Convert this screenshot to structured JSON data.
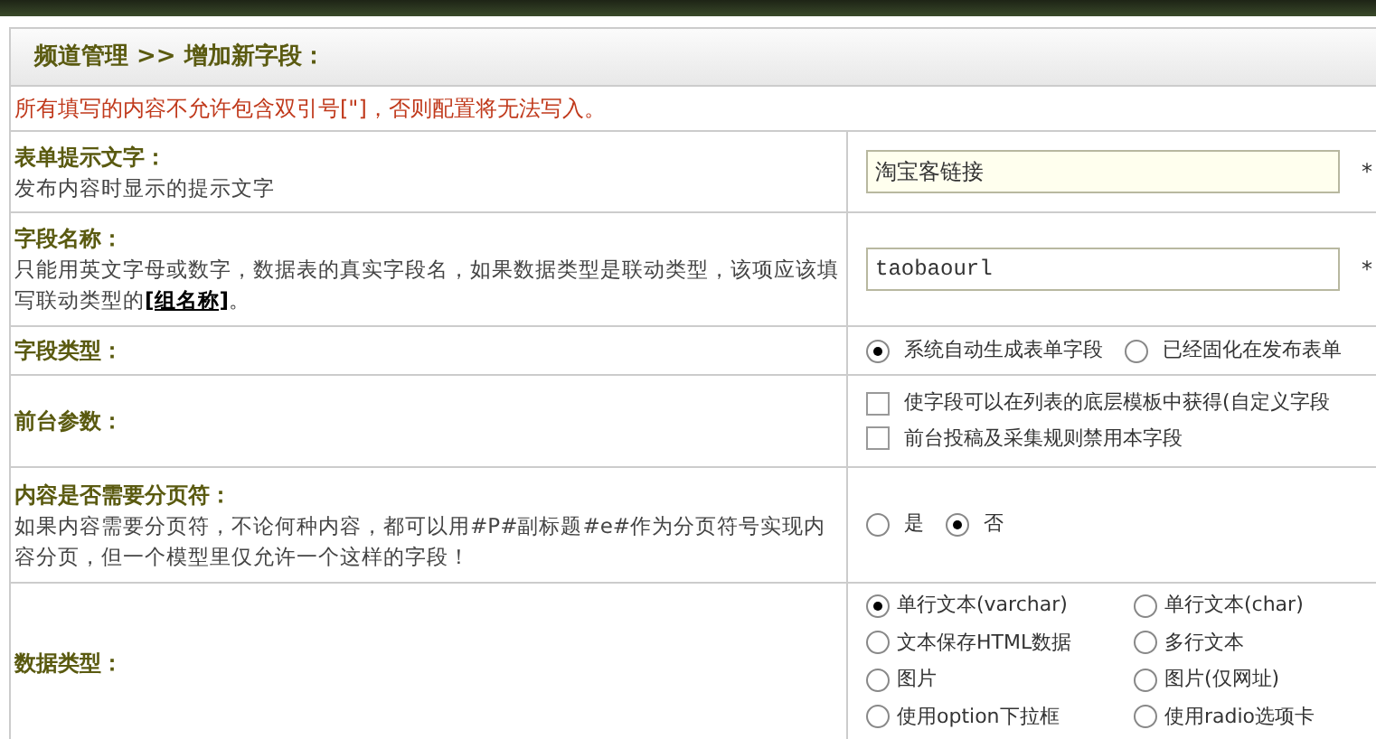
{
  "header": {
    "title": "频道管理 >> 增加新字段："
  },
  "notice": "所有填写的内容不允许包含双引号[\"]，否则配置将无法写入。",
  "rows": [
    {
      "kind": "text",
      "label": "表单提示文字：",
      "desc": "发布内容时显示的提示文字",
      "value": "淘宝客链接",
      "required": "*",
      "mono": false
    },
    {
      "kind": "text",
      "label": "字段名称：",
      "desc": "只能用英文字母或数字，数据表的真实字段名，如果数据类型是联动类型，该项应该填写联动类型的",
      "link": "[组名称]",
      "desc_end": "。",
      "value": "taobaourl",
      "required": "*",
      "mono": true
    },
    {
      "kind": "radio",
      "label": "字段类型：",
      "options": [
        {
          "label": "系统自动生成表单字段",
          "selected": true
        },
        {
          "label": "已经固化在发布表单",
          "selected": false
        }
      ]
    },
    {
      "kind": "check",
      "label": "前台参数：",
      "options": [
        {
          "label": "使字段可以在列表的底层模板中获得(自定义字段",
          "checked": false
        },
        {
          "label": "前台投稿及采集规则禁用本字段",
          "checked": false
        }
      ]
    },
    {
      "kind": "radio",
      "label": "内容是否需要分页符：",
      "desc": "如果内容需要分页符，不论何种内容，都可以用#P#副标题#e#作为分页符号实现内容分页，但一个模型里仅允许一个这样的字段！",
      "options": [
        {
          "label": "是",
          "selected": false
        },
        {
          "label": "否",
          "selected": true
        }
      ]
    },
    {
      "kind": "grid",
      "label": "数据类型：",
      "options": [
        {
          "label": "单行文本(varchar)",
          "selected": true
        },
        {
          "label": "单行文本(char)",
          "selected": false
        },
        {
          "label": "文本保存HTML数据",
          "selected": false
        },
        {
          "label": "多行文本",
          "selected": false
        },
        {
          "label": "图片",
          "selected": false
        },
        {
          "label": "图片(仅网址)",
          "selected": false
        },
        {
          "label": "使用option下拉框",
          "selected": false
        },
        {
          "label": "使用radio选项卡",
          "selected": false
        }
      ]
    }
  ]
}
